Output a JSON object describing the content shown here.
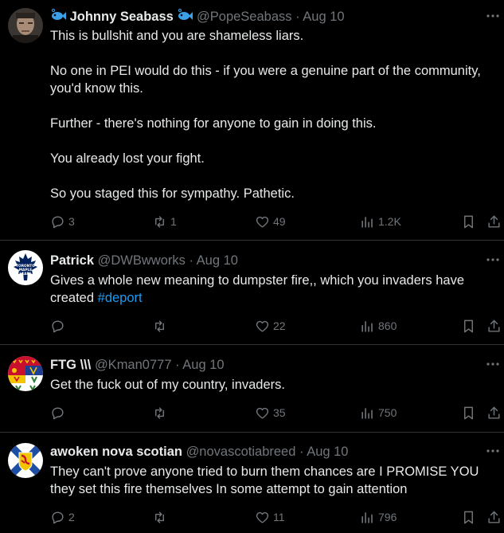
{
  "tweets": [
    {
      "name": "Johnny Seabass",
      "handle": "@PopeSeabass",
      "separator": "·",
      "date": "Aug 10",
      "lines": [
        "This is bullshit and you are shameless liars.",
        "",
        "No one in PEI would do this - if you were a genuine part of the community,",
        "you'd know this.",
        "",
        "Further - there's nothing for anyone to gain in doing this.",
        "",
        "You already lost your fight.",
        "",
        "So you staged this for sympathy. Pathetic."
      ],
      "replies": "3",
      "retweets": "1",
      "likes": "49",
      "views": "1.2K"
    },
    {
      "name": "Patrick",
      "handle": "@DWBwworks",
      "separator": "·",
      "date": "Aug 10",
      "lines": [
        "Gives a whole new meaning to dumpster fire,, which you invaders have",
        "created"
      ],
      "hashtag": "#deport",
      "replies": "",
      "retweets": "",
      "likes": "22",
      "views": "860",
      "avatar_text": [
        "TORONTO",
        "MAPLE",
        "LEAFS"
      ]
    },
    {
      "name": "FTG \\\\\\",
      "handle": "@Kman0777",
      "separator": "·",
      "date": "Aug 10",
      "lines": [
        "Get the fuck out of my country, invaders."
      ],
      "replies": "",
      "retweets": "",
      "likes": "35",
      "views": "750"
    },
    {
      "name": "awoken nova scotian",
      "handle": "@novascotiabreed",
      "separator": "·",
      "date": "Aug 10",
      "lines": [
        "They can't prove anyone tried to burn them chances are I PROMISE YOU",
        "they set this fire themselves In some attempt to gain attention"
      ],
      "replies": "2",
      "retweets": "",
      "likes": "11",
      "views": "796"
    }
  ],
  "icons": {
    "more": "more-icon",
    "reply": "reply-icon",
    "retweet": "retweet-icon",
    "like": "heart-icon",
    "views": "views-icon",
    "bookmark": "bookmark-icon",
    "share": "share-icon",
    "fish": "fish-emoji-icon"
  },
  "colors": {
    "background": "#000000",
    "text": "#e7e9ea",
    "muted": "#71767b",
    "link": "#1d9bf0",
    "divider": "#2f3336"
  }
}
